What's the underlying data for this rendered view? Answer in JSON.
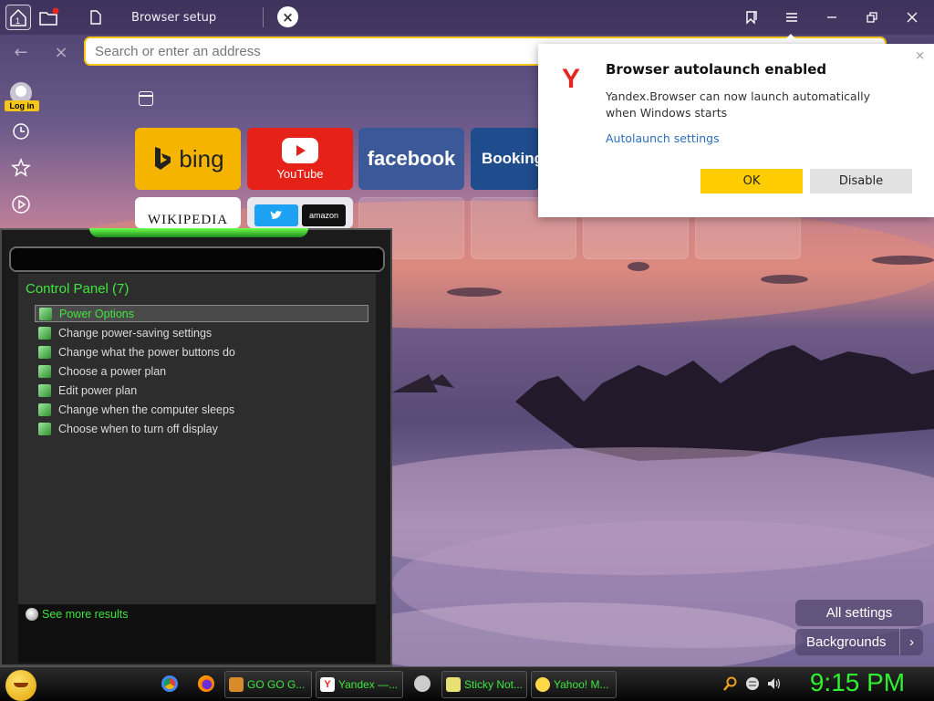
{
  "browser": {
    "home_badge": "1",
    "tab_title": "Browser setup",
    "address_placeholder": "Search or enter an address",
    "login_label": "Log in"
  },
  "speed_dial": {
    "bing": "bing",
    "youtube": "YouTube",
    "facebook": "facebook",
    "booking": "Booking.",
    "wikipedia": "WIKIPEDIA",
    "amazon": "amazon"
  },
  "popup": {
    "title": "Browser autolaunch enabled",
    "body": "Yandex.Browser can now launch automatically when Windows starts",
    "link": "Autolaunch settings",
    "ok": "OK",
    "disable": "Disable",
    "close_symbol": "×",
    "logo": "Y"
  },
  "search_panel": {
    "heading": "Control Panel (7)",
    "results": [
      "Power Options",
      "Change power-saving settings",
      "Change what the power buttons do",
      "Choose a power plan",
      "Edit power plan",
      "Change when the computer sleeps",
      "Choose when to turn off display"
    ],
    "more": "See more results"
  },
  "settings": {
    "all": "All settings",
    "backgrounds": "Backgrounds",
    "chevron": "›"
  },
  "taskbar": {
    "tasks": [
      "GO GO G...",
      "Yandex —...",
      "Sticky Not...",
      "Yahoo! M..."
    ],
    "clock": "9:15 PM"
  },
  "colors": {
    "accent_yellow": "#ffcc00",
    "link_blue": "#2a6fbd",
    "neon_green": "#3ee63e",
    "yandex_red": "#e52620"
  }
}
